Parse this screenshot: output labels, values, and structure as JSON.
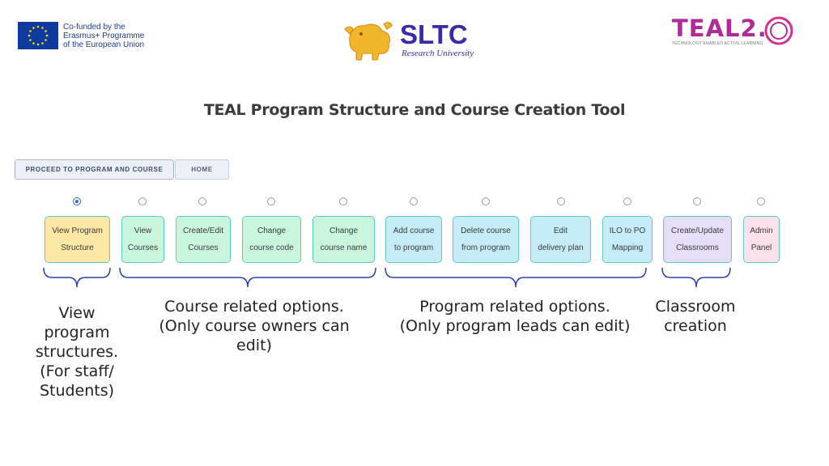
{
  "header": {
    "eu_lines": [
      "Co-funded by the",
      "Erasmus+ Programme",
      "of the European Union"
    ],
    "sltc_name": "SLTC",
    "sltc_sub": "Research University",
    "teal_name": "TEAL2.",
    "teal_tagline": "TECHNOLOGY ENABLED ACTIVE LEARNING"
  },
  "page_title": "TEAL Program Structure and Course Creation Tool",
  "nav": {
    "proceed_label": "PROCEED TO PROGRAM AND COURSE",
    "home_label": "HOME"
  },
  "options": [
    {
      "line1": "View Program",
      "line2": "Structure",
      "color": "#fde8a6",
      "selected": true
    },
    {
      "line1": "View",
      "line2": "Courses",
      "color": "#c9f5dc",
      "selected": false
    },
    {
      "line1": "Create/Edit",
      "line2": "Courses",
      "color": "#c9f5dc",
      "selected": false
    },
    {
      "line1": "Change",
      "line2": "course code",
      "color": "#c9f5dc",
      "selected": false
    },
    {
      "line1": "Change",
      "line2": "course name",
      "color": "#c9f5dc",
      "selected": false
    },
    {
      "line1": "Add course",
      "line2": "to program",
      "color": "#c6ecfa",
      "selected": false
    },
    {
      "line1": "Delete course",
      "line2": "from program",
      "color": "#c6ecfa",
      "selected": false
    },
    {
      "line1": "Edit",
      "line2": "delivery plan",
      "color": "#c6ecfa",
      "selected": false
    },
    {
      "line1": "ILO to PO",
      "line2": "Mapping",
      "color": "#c6ecfa",
      "selected": false
    },
    {
      "line1": "Create/Update",
      "line2": "Classrooms",
      "color": "#e5def7",
      "selected": false
    },
    {
      "line1": "Admin",
      "line2": "Panel",
      "color": "#fde1ea",
      "selected": false
    }
  ],
  "captions": {
    "view": [
      "View",
      "program",
      "structures.",
      "(For staff/",
      "Students)"
    ],
    "course": [
      "Course related options.",
      "(Only course owners can",
      "edit)"
    ],
    "program": [
      "Program related options.",
      "(Only program leads can edit)"
    ],
    "classroom": [
      "Classroom",
      "creation"
    ]
  },
  "colors": {
    "accent_blue": "#2b6cd8",
    "brace": "#2b3fa8",
    "sltc_purple": "#3a2aa8",
    "teal_magenta": "#b02a9a"
  }
}
